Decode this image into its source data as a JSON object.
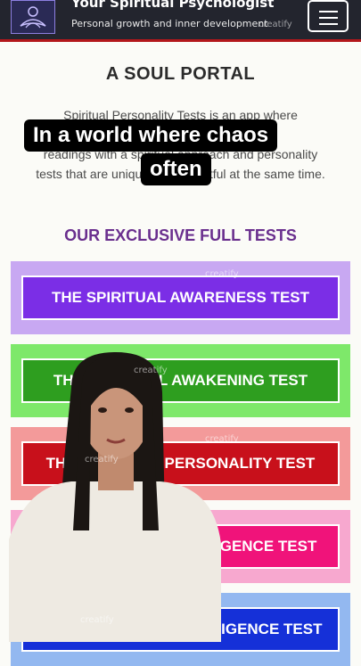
{
  "header": {
    "site_title": "Your Spiritual Psychologist",
    "tagline": "Personal growth and inner development",
    "logo_icon": "lotus-meditation-logo",
    "menu_icon": "hamburger-menu-icon"
  },
  "main": {
    "heading": "A SOUL PORTAL",
    "intro_line1": "Spiritual Personality Tests is an app where",
    "intro_line2": "readings with a spiritual approach and personality",
    "intro_line3": "tests that are unique and insightful at the same time.",
    "section_heading": "OUR EXCLUSIVE FULL TESTS",
    "tests": [
      {
        "label": "THE SPIRITUAL AWARENESS TEST",
        "color": "#7b2ee6",
        "frame": "#c8a8f2"
      },
      {
        "label": "THE SPIRITUAL AWAKENING TEST",
        "color": "#2e9e1f",
        "frame": "#7ee86a"
      },
      {
        "label": "THE SPIRITUAL PERSONALITY TEST",
        "color": "#c8101b",
        "frame": "#f39a9a"
      },
      {
        "label": "THE SPIRITUAL INTELLIGENCE TEST",
        "color": "#f0137a",
        "frame": "#f7a8cf"
      },
      {
        "label": "THE EMOTIONAL INTELLIGENCE TEST",
        "color": "#1530d8",
        "frame": "#93b8f0"
      }
    ]
  },
  "captions": {
    "line1": "In a world where chaos",
    "line2": "often"
  },
  "watermark": "creatify"
}
